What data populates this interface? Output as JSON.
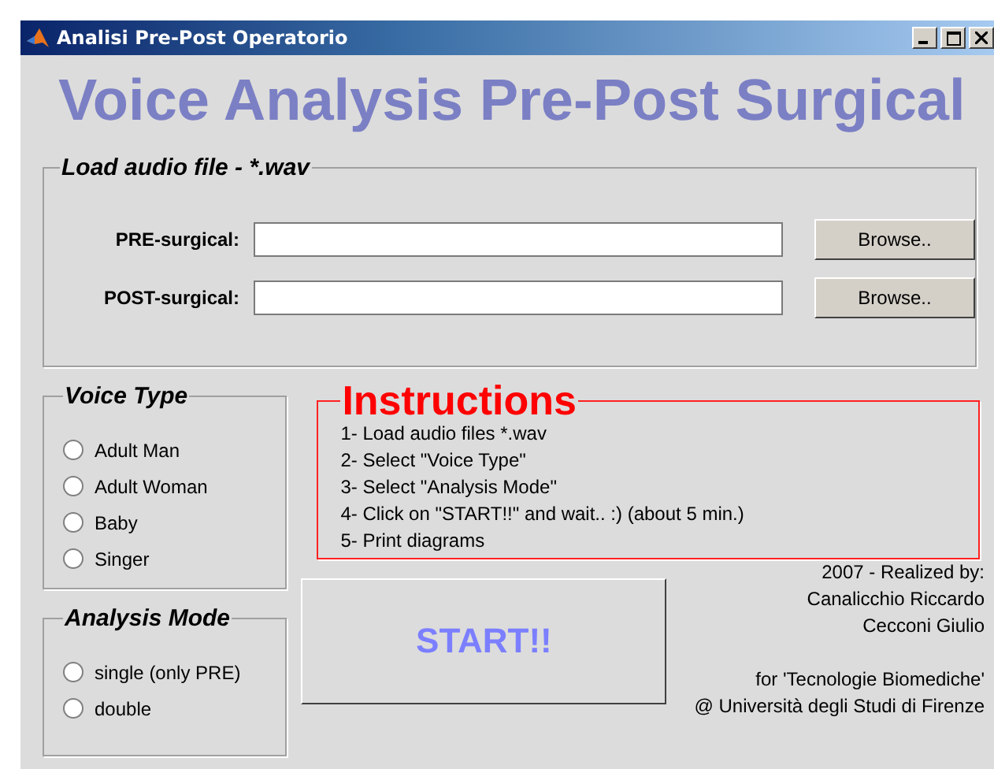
{
  "window": {
    "title": "Analisi Pre-Post Operatorio"
  },
  "heading": "Voice Analysis Pre-Post Surgical",
  "load_panel": {
    "title": "Load audio file - *.wav",
    "fields": [
      {
        "label": "PRE-surgical:",
        "button": "Browse.."
      },
      {
        "label": "POST-surgical:",
        "button": "Browse.."
      }
    ]
  },
  "voice_type": {
    "title": "Voice Type",
    "options": [
      {
        "label": "Adult Man",
        "selected": false
      },
      {
        "label": "Adult Woman",
        "selected": false
      },
      {
        "label": "Baby",
        "selected": false
      },
      {
        "label": "Singer",
        "selected": false
      }
    ]
  },
  "analysis_mode": {
    "title": "Analysis Mode",
    "options": [
      {
        "label": "single (only PRE)",
        "selected": false
      },
      {
        "label": "double",
        "selected": false
      }
    ]
  },
  "instructions": {
    "title": "Instructions",
    "steps": [
      "1- Load audio files *.wav",
      "2- Select \"Voice Type\"",
      "3- Select  \"Analysis Mode\"",
      "4- Click on \"START!!\" and wait.. :) (about 5 min.)",
      "5- Print diagrams"
    ]
  },
  "start_button": "START!!",
  "credits": {
    "authors": [
      "2007 - Realized by:",
      "Canalicchio Riccardo",
      "Cecconi Giulio"
    ],
    "affiliation": [
      "for 'Tecnologie Biomediche'",
      "@ Università degli Studi di Firenze"
    ]
  }
}
